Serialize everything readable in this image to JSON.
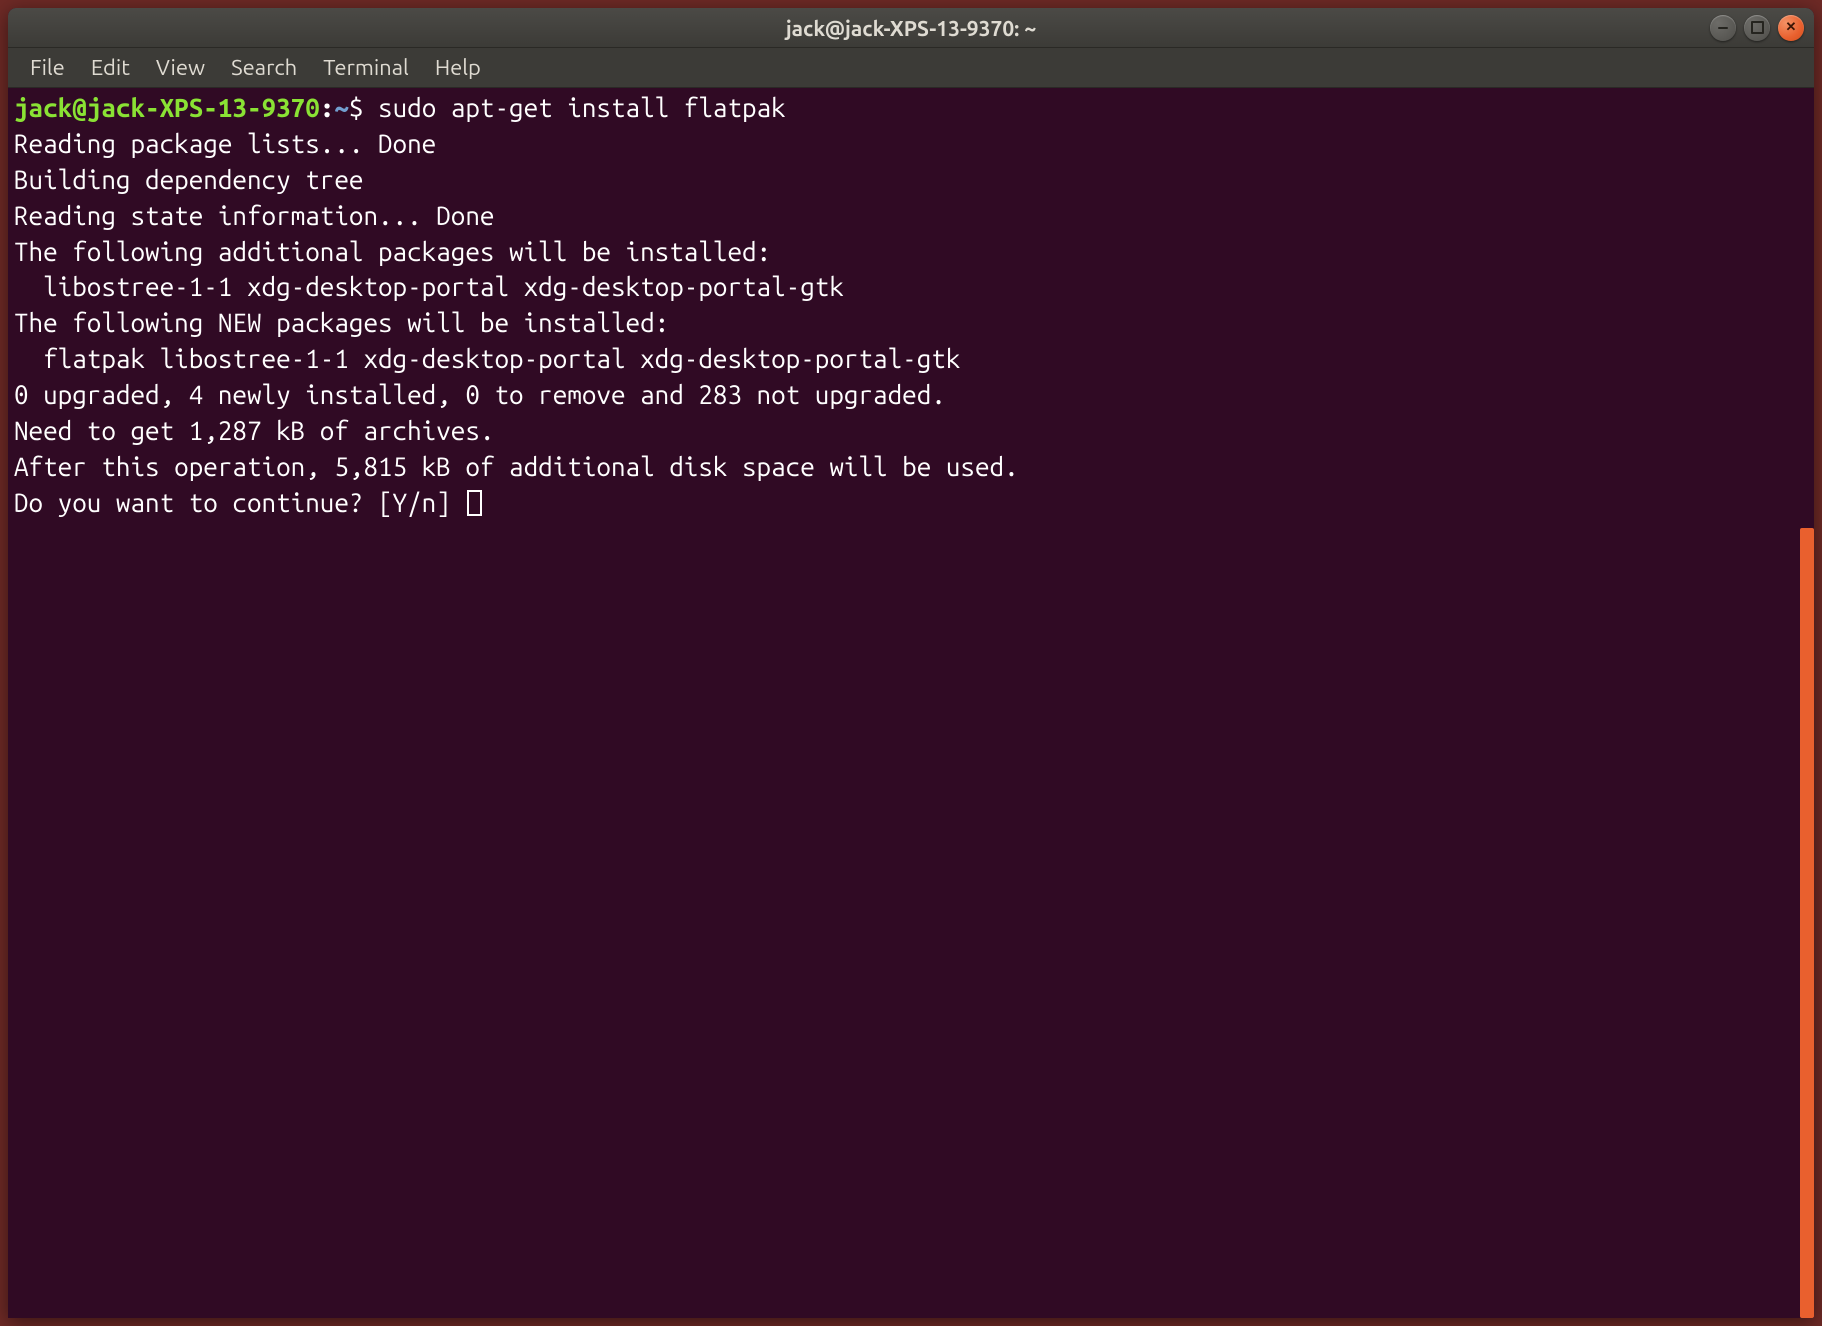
{
  "window": {
    "title": "jack@jack-XPS-13-9370: ~"
  },
  "menubar": {
    "items": [
      "File",
      "Edit",
      "View",
      "Search",
      "Terminal",
      "Help"
    ]
  },
  "prompt": {
    "user_host": "jack@jack-XPS-13-9370",
    "colon": ":",
    "path": "~",
    "dollar": "$ ",
    "command": "sudo apt-get install flatpak"
  },
  "output": {
    "lines": [
      "Reading package lists... Done",
      "Building dependency tree",
      "Reading state information... Done",
      "The following additional packages will be installed:",
      "  libostree-1-1 xdg-desktop-portal xdg-desktop-portal-gtk",
      "The following NEW packages will be installed:",
      "  flatpak libostree-1-1 xdg-desktop-portal xdg-desktop-portal-gtk",
      "0 upgraded, 4 newly installed, 0 to remove and 283 not upgraded.",
      "Need to get 1,287 kB of archives.",
      "After this operation, 5,815 kB of additional disk space will be used.",
      "Do you want to continue? [Y/n] "
    ]
  },
  "colors": {
    "terminal_bg": "#300a24",
    "titlebar_bg": "#3c3b37",
    "prompt_user": "#8ae234",
    "prompt_path": "#729fcf",
    "close_btn": "#e9602e",
    "text": "#ffffff"
  }
}
